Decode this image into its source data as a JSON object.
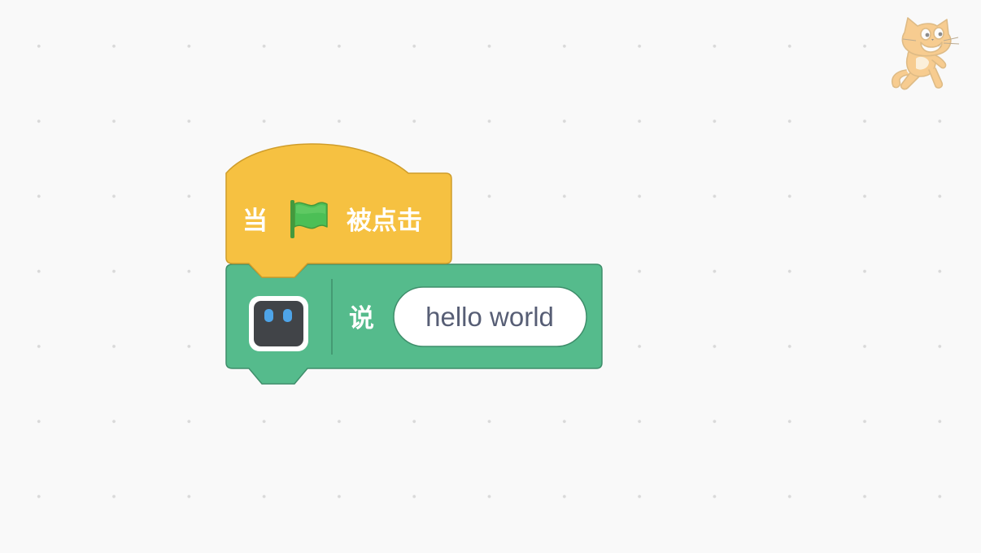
{
  "script": {
    "event_block": {
      "prefix": "当",
      "suffix": "被点击",
      "icon": "green-flag-icon",
      "color": "#f6c141",
      "border_color": "#cf9d2b"
    },
    "say_block": {
      "extension_icon": "robot-face-icon",
      "label": "说",
      "message": "hello world",
      "color": "#55bb8c",
      "border_color": "#3f8e6b"
    }
  },
  "corner_mascot": {
    "icon": "scratch-cat-icon"
  },
  "workspace": {
    "background_color": "#f9f9f9",
    "grid_dot_color": "#d9d9d9"
  }
}
